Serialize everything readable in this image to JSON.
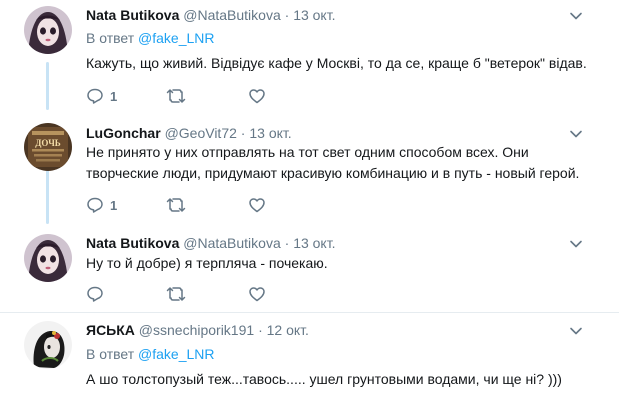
{
  "tweets": [
    {
      "name": "Nata Butikova",
      "handle": "@NataButikova",
      "sep": "·",
      "date": "13 окт.",
      "reply_prefix": "В ответ",
      "reply_handle": "@fake_LNR",
      "text": "Кажуть, що живий. Відвідує кафе у Москві, то да се, краще б  \"ветерок\" відав.",
      "reply_count": "1",
      "retweet_count": "",
      "like_count": ""
    },
    {
      "name": "LuGonchar",
      "handle": "@GeoVit72",
      "sep": "·",
      "date": "13 окт.",
      "avatar_text_top": "ДОЧЬ",
      "text": "Не принято у них отправлять на тот свет одним способом всех. Они творческие люди, придумают красивую комбинацию и в путь - новый герой.",
      "reply_count": "1",
      "retweet_count": "",
      "like_count": ""
    },
    {
      "name": "Nata Butikova",
      "handle": "@NataButikova",
      "sep": "·",
      "date": "13 окт.",
      "text": "Ну то й добре) я терпляча - почекаю.",
      "reply_count": "",
      "retweet_count": "",
      "like_count": ""
    },
    {
      "name": "ЯСЬКА",
      "handle": "@ssnechiporik191",
      "sep": "·",
      "date": "12 окт.",
      "reply_prefix": "В ответ",
      "reply_handle": "@fake_LNR",
      "text": "А шо толстопузый теж...тавось..... ушел грунтовыми водами, чи ще ні? )))"
    }
  ],
  "icons": {
    "reply": "reply-icon",
    "retweet": "retweet-icon",
    "like": "heart-icon",
    "caret": "chevron-down-icon"
  },
  "colors": {
    "link": "#1da1f2",
    "muted": "#657786",
    "thread_line": "#c8e3f5",
    "divider": "#e6ecf0"
  }
}
